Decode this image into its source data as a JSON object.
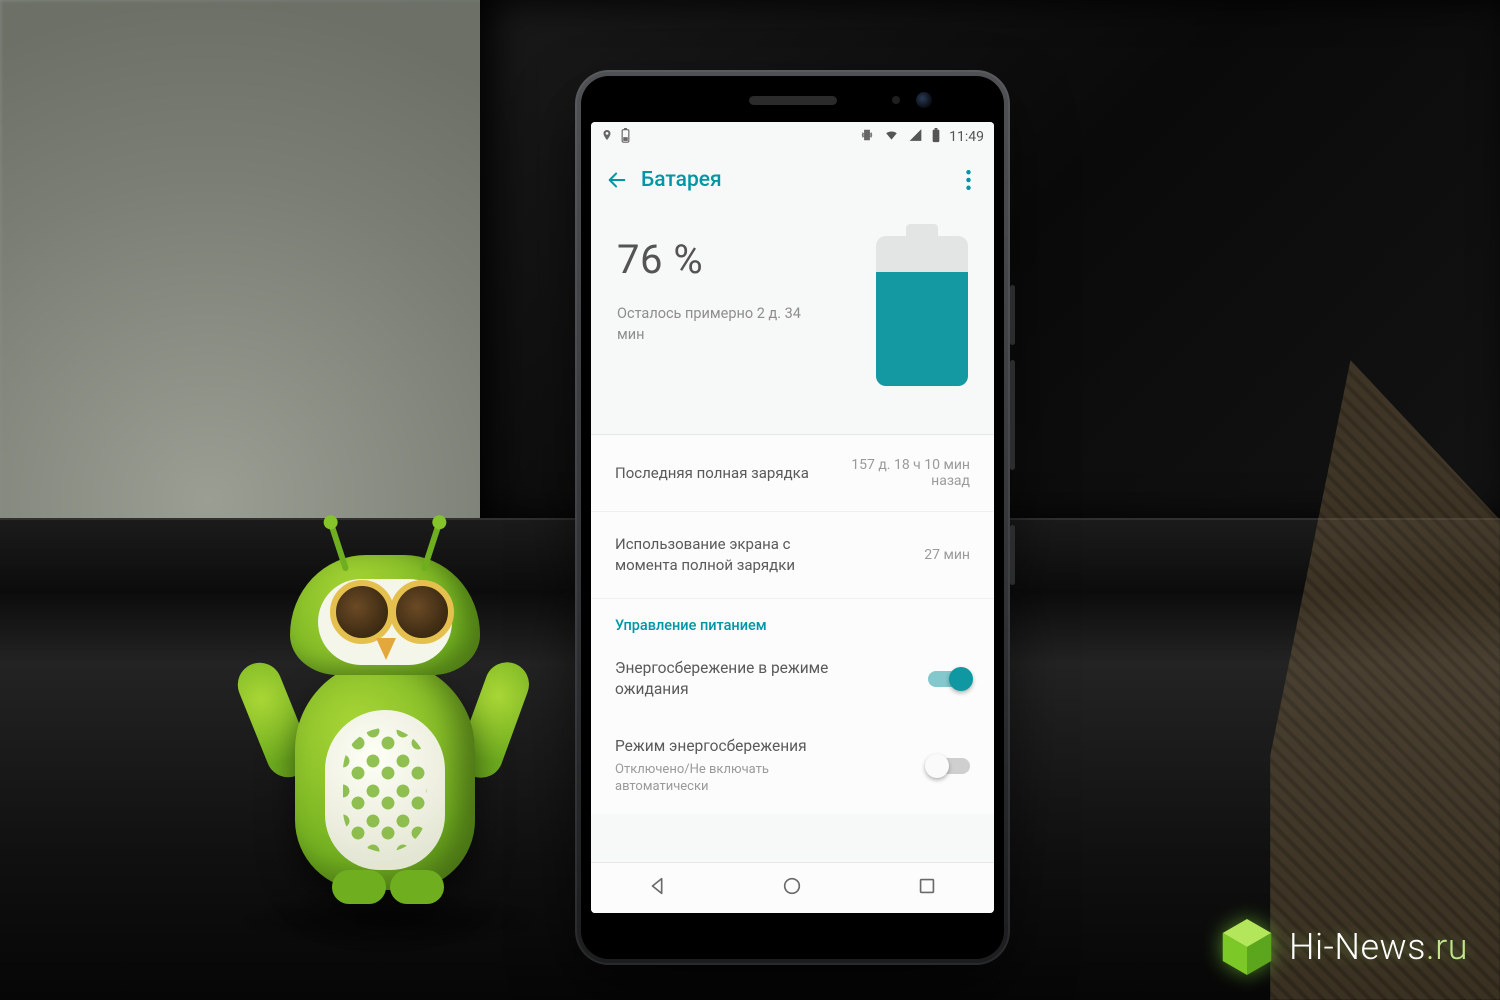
{
  "status_bar": {
    "time": "11:49"
  },
  "appbar": {
    "title": "Батарея"
  },
  "battery": {
    "percent_label": "76 %",
    "percent_value": 76,
    "estimate": "Осталось примерно 2 д. 34 мин"
  },
  "rows": {
    "last_full_charge": {
      "label": "Последняя полная зарядка",
      "value": "157 д. 18 ч 10 мин назад"
    },
    "screen_usage": {
      "label": "Использование экрана с момента полной зарядки",
      "value": "27 мин"
    }
  },
  "power": {
    "header": "Управление питанием",
    "standby_saver": {
      "title": "Энергосбережение в режиме ожидания",
      "on": true
    },
    "battery_saver": {
      "title": "Режим энергосбережения",
      "subtitle": "Отключено/Не включать автоматически",
      "on": false
    }
  },
  "watermark": {
    "brand": "Hi-News",
    "suffix": ".ru"
  }
}
